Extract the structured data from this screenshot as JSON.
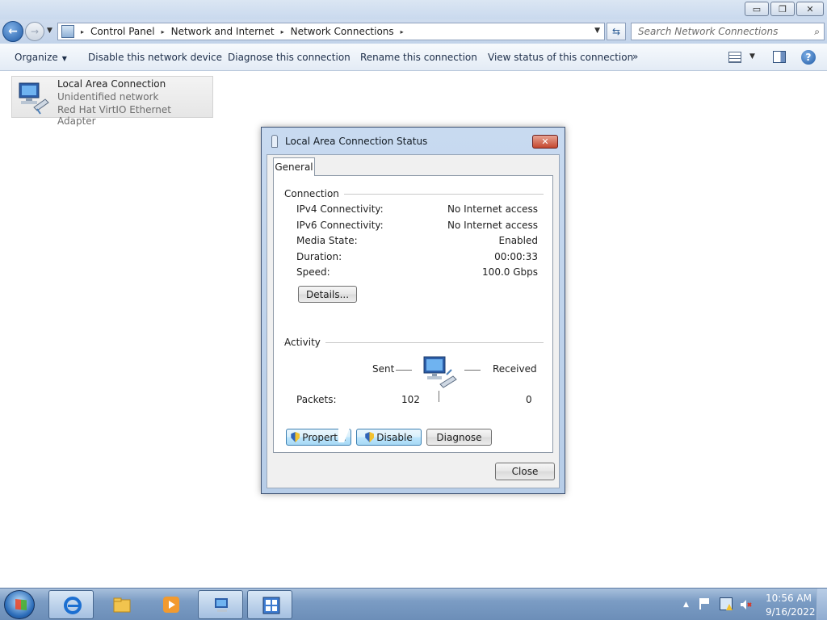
{
  "window": {
    "minimize_glyph": "▭",
    "maximize_glyph": "❐",
    "close_glyph": "✕"
  },
  "address": {
    "crumbs": [
      "Control Panel",
      "Network and Internet",
      "Network Connections"
    ],
    "separator": "▸",
    "search_placeholder": "Search Network Connections"
  },
  "toolbar": {
    "organize": "Organize",
    "disable": "Disable this network device",
    "diagnose": "Diagnose this connection",
    "rename": "Rename this connection",
    "view_status": "View status of this connection",
    "more": "»"
  },
  "connection": {
    "name": "Local Area Connection",
    "status": "Unidentified network",
    "adapter": "Red Hat VirtIO Ethernet Adapter"
  },
  "dialog": {
    "title": "Local Area Connection Status",
    "tab": "General",
    "connection_group": "Connection",
    "rows": [
      {
        "label": "IPv4 Connectivity:",
        "value": "No Internet access"
      },
      {
        "label": "IPv6 Connectivity:",
        "value": "No Internet access"
      },
      {
        "label": "Media State:",
        "value": "Enabled"
      },
      {
        "label": "Duration:",
        "value": "00:00:33"
      },
      {
        "label": "Speed:",
        "value": "100.0 Gbps"
      }
    ],
    "details_button": "Details...",
    "activity_group": "Activity",
    "sent_label": "Sent",
    "received_label": "Received",
    "packets_label": "Packets:",
    "packets_sent": "102",
    "packets_received": "0",
    "properties_button": "Propertie",
    "disable_button": "Disable",
    "diagnose_button": "Diagnose",
    "close_button": "Close"
  },
  "taskbar": {
    "time": "10:56 AM",
    "date": "9/16/2022"
  },
  "colors": {
    "accent": "#1f5aa6",
    "taskbar": "#7b9cc4",
    "close_red": "#c4482f"
  }
}
